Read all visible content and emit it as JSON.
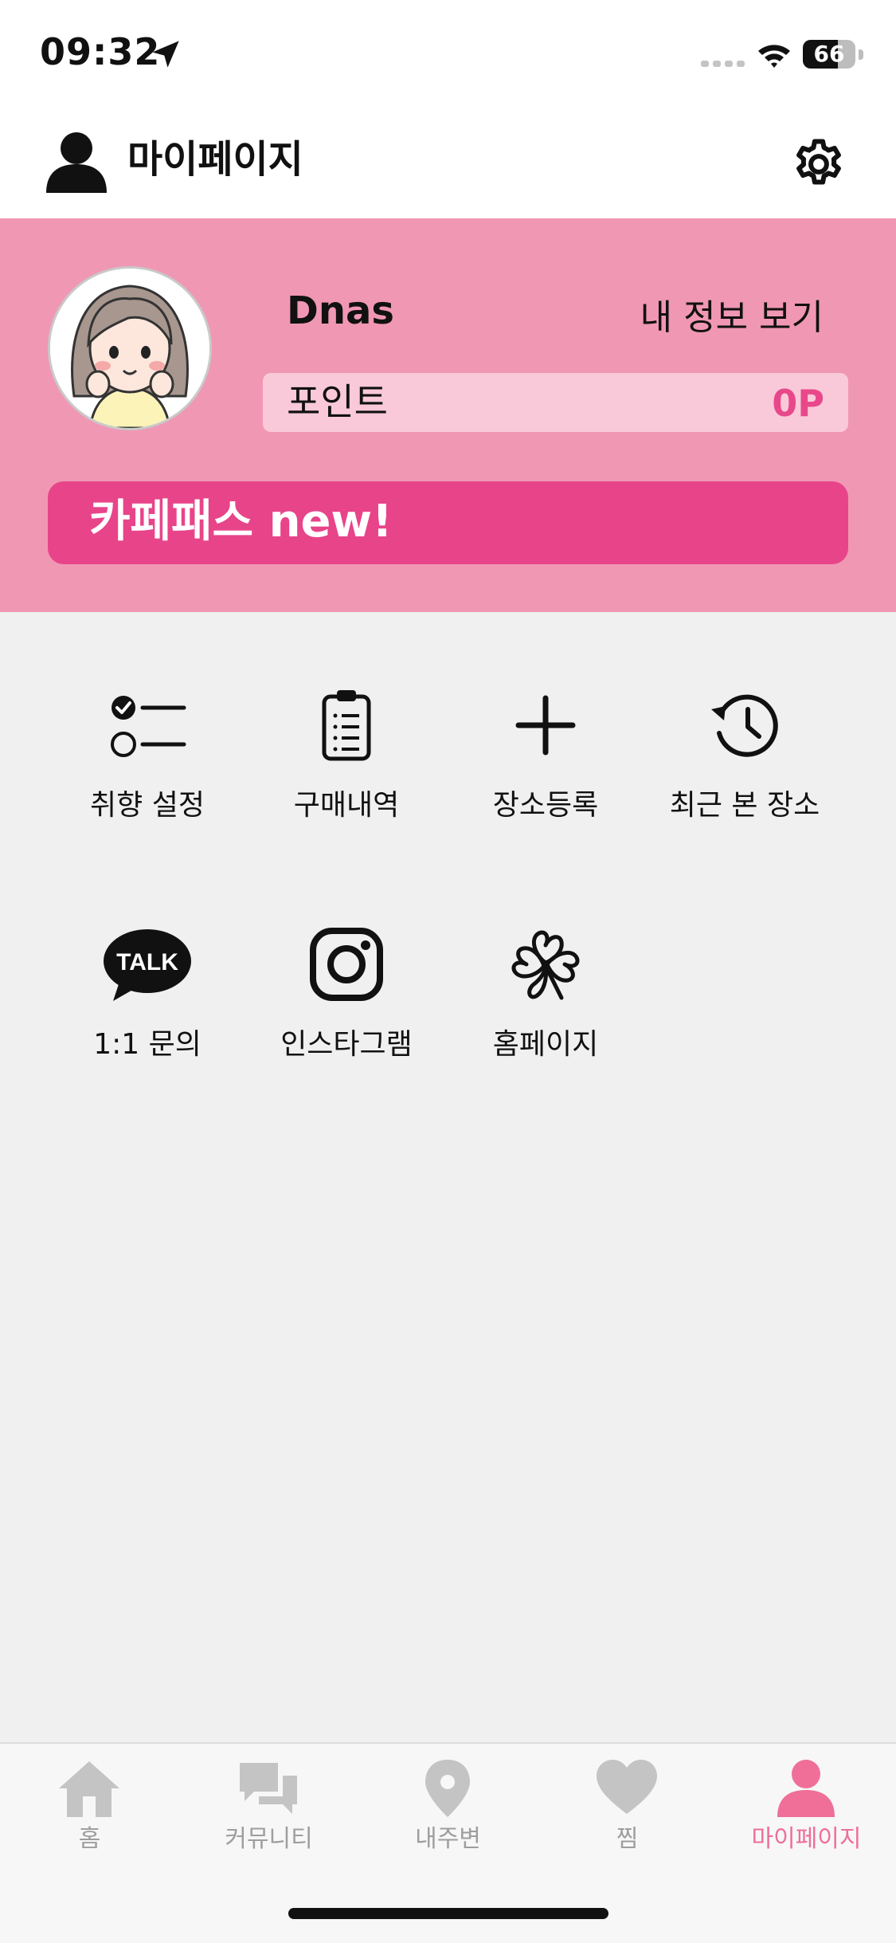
{
  "status_bar": {
    "time": "09:32",
    "battery": "66",
    "battery_level": 0.66
  },
  "header": {
    "title": "마이페이지",
    "settings_icon": "gear-icon",
    "user_icon": "person-icon"
  },
  "profile": {
    "username": "Dnas",
    "my_info_label": "내 정보 보기",
    "point_label": "포인트",
    "point_value": "0P",
    "cafepass_label": "카페패스 new!"
  },
  "menu": {
    "items": [
      {
        "label": "취향 설정",
        "icon": "checklist-icon"
      },
      {
        "label": "구매내역",
        "icon": "clipboard-icon"
      },
      {
        "label": "장소등록",
        "icon": "plus-icon"
      },
      {
        "label": "최근 본 장소",
        "icon": "history-icon"
      },
      {
        "label": "1:1 문의",
        "icon": "kakaotalk-icon",
        "icon_text": "TALK"
      },
      {
        "label": "인스타그램",
        "icon": "instagram-icon"
      },
      {
        "label": "홈페이지",
        "icon": "clover-logo-icon"
      }
    ]
  },
  "tabbar": {
    "tabs": [
      {
        "label": "홈",
        "icon": "home-icon",
        "active": false
      },
      {
        "label": "커뮤니티",
        "icon": "chat-bubbles-icon",
        "active": false
      },
      {
        "label": "내주변",
        "icon": "map-pin-icon",
        "active": false
      },
      {
        "label": "찜",
        "icon": "heart-icon",
        "active": false
      },
      {
        "label": "마이페이지",
        "icon": "person-icon",
        "active": true
      }
    ]
  },
  "colors": {
    "profile_bg": "#f097b4",
    "point_box": "#f9c9d9",
    "accent": "#e8448a",
    "tab_active": "#ef6f99",
    "tab_inactive": "#c4c4c4",
    "page_bg": "#f0f0f0"
  }
}
